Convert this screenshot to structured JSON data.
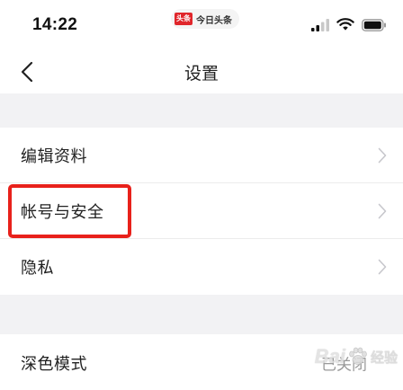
{
  "status_bar": {
    "time": "14:22",
    "app_badge_logo": "头条",
    "app_badge_text": "今日头条"
  },
  "nav": {
    "title": "设置",
    "back_icon": "chevron-left-icon"
  },
  "settings": {
    "items": [
      {
        "label": "编辑资料"
      },
      {
        "label": "帐号与安全"
      },
      {
        "label": "隐私"
      },
      {
        "label": "深色模式",
        "value": "已关闭"
      }
    ]
  },
  "watermark": {
    "text": "Bai",
    "sub": "经验"
  },
  "colors": {
    "highlight": "#e8211b",
    "section_gap": "#f2f2f4",
    "chevron": "#c7c7cc",
    "logo_red": "#e0262b"
  }
}
